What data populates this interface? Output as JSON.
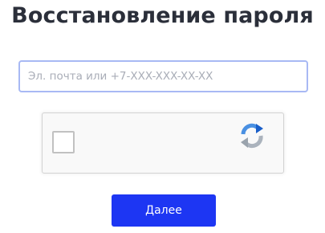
{
  "page": {
    "title": "Восстановление пароля"
  },
  "form": {
    "login_placeholder": "Эл. почта или +7-XXX-XXX-XX-XX",
    "login_value": ""
  },
  "captcha": {
    "checked": false,
    "icon": "recaptcha-logo-icon"
  },
  "actions": {
    "next_label": "Далее"
  },
  "colors": {
    "title": "#2b2f3a",
    "input_border_focus": "#a8b9f4",
    "button_bg": "#1d36f3",
    "button_text": "#ffffff",
    "captcha_bg": "#f9f9f9"
  }
}
